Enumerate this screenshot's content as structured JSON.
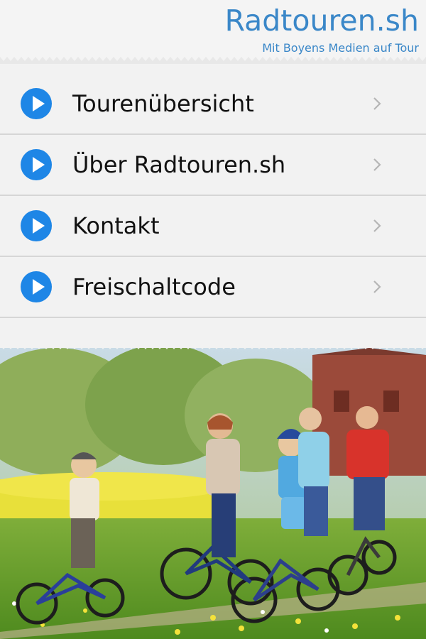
{
  "header": {
    "title": "Radtouren.sh",
    "subtitle": "Mit Boyens Medien auf Tour"
  },
  "menu": {
    "items": [
      {
        "label": "Tourenübersicht",
        "icon": "play-circle-icon"
      },
      {
        "label": "Über Radtouren.sh",
        "icon": "play-circle-icon"
      },
      {
        "label": "Kontakt",
        "icon": "play-circle-icon"
      },
      {
        "label": "Freischaltcode",
        "icon": "play-circle-icon"
      }
    ],
    "chevron_icon": "chevron-right-icon"
  },
  "photo": {
    "subject": "family-cycling-photo"
  },
  "colors": {
    "accent": "#3a87c8",
    "play_button": "#1e86e6",
    "background": "#f2f2f2",
    "divider": "#d6d6d6"
  }
}
